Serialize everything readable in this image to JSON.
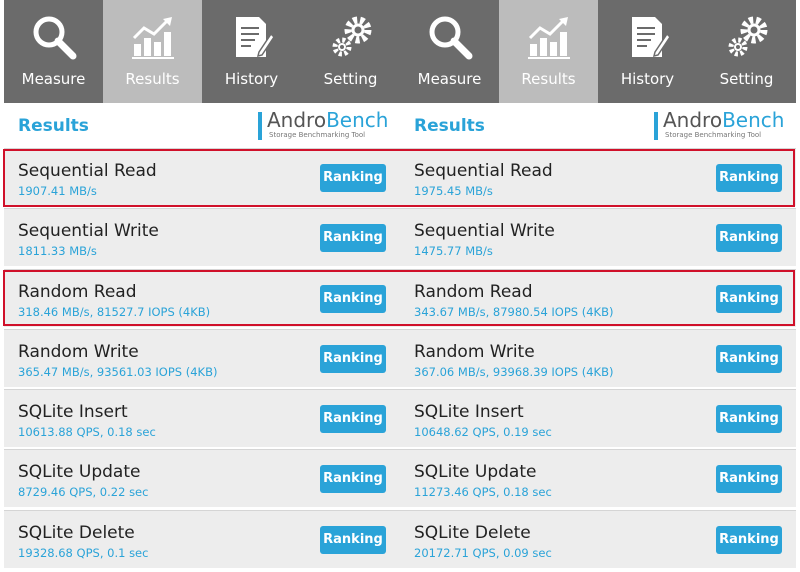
{
  "panels": [
    {
      "tabs": [
        {
          "label": "Measure",
          "icon": "magnifier-icon"
        },
        {
          "label": "Results",
          "icon": "bar-chart-icon",
          "active": true
        },
        {
          "label": "History",
          "icon": "document-pen-icon"
        },
        {
          "label": "Setting",
          "icon": "gears-icon"
        }
      ],
      "results_title": "Results",
      "logo": {
        "andro": "Andro",
        "bench": "Bench",
        "sub": "Storage Benchmarking Tool"
      },
      "rows": [
        {
          "title": "Sequential Read",
          "value": "1907.41 MB/s",
          "button": "Ranking"
        },
        {
          "title": "Sequential Write",
          "value": "1811.33 MB/s",
          "button": "Ranking"
        },
        {
          "title": "Random Read",
          "value": "318.46 MB/s, 81527.7 IOPS (4KB)",
          "button": "Ranking"
        },
        {
          "title": "Random Write",
          "value": "365.47 MB/s, 93561.03 IOPS (4KB)",
          "button": "Ranking"
        },
        {
          "title": "SQLite Insert",
          "value": "10613.88 QPS, 0.18 sec",
          "button": "Ranking"
        },
        {
          "title": "SQLite Update",
          "value": "8729.46 QPS, 0.22 sec",
          "button": "Ranking"
        },
        {
          "title": "SQLite Delete",
          "value": "19328.68 QPS, 0.1 sec",
          "button": "Ranking"
        }
      ]
    },
    {
      "tabs": [
        {
          "label": "Measure",
          "icon": "magnifier-icon"
        },
        {
          "label": "Results",
          "icon": "bar-chart-icon",
          "active": true
        },
        {
          "label": "History",
          "icon": "document-pen-icon"
        },
        {
          "label": "Setting",
          "icon": "gears-icon"
        }
      ],
      "results_title": "Results",
      "logo": {
        "andro": "Andro",
        "bench": "Bench",
        "sub": "Storage Benchmarking Tool"
      },
      "rows": [
        {
          "title": "Sequential Read",
          "value": "1975.45 MB/s",
          "button": "Ranking"
        },
        {
          "title": "Sequential Write",
          "value": "1475.77 MB/s",
          "button": "Ranking"
        },
        {
          "title": "Random Read",
          "value": "343.67 MB/s, 87980.54 IOPS (4KB)",
          "button": "Ranking"
        },
        {
          "title": "Random Write",
          "value": "367.06 MB/s, 93968.39 IOPS (4KB)",
          "button": "Ranking"
        },
        {
          "title": "SQLite Insert",
          "value": "10648.62 QPS, 0.19 sec",
          "button": "Ranking"
        },
        {
          "title": "SQLite Update",
          "value": "11273.46 QPS, 0.18 sec",
          "button": "Ranking"
        },
        {
          "title": "SQLite Delete",
          "value": "20172.71 QPS, 0.09 sec",
          "button": "Ranking"
        }
      ]
    }
  ],
  "colors": {
    "accent": "#2aa3d8",
    "tabbar": "#6b6b6b",
    "tab_active": "#bcbcbc",
    "highlight": "#d0102a",
    "row_bg": "#ededed"
  }
}
